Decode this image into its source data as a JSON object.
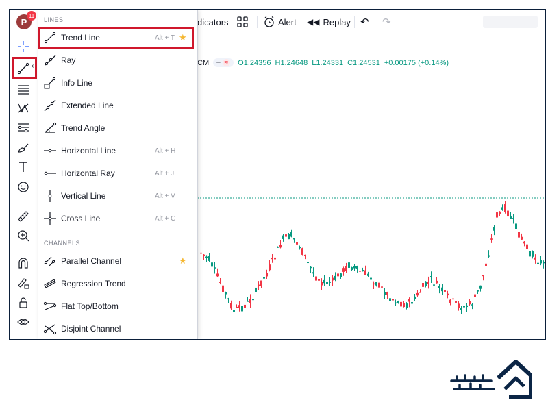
{
  "topbar": {
    "indicators_label": "dicators",
    "alert_label": "Alert",
    "replay_label": "Replay"
  },
  "account": {
    "avatar_letter": "P",
    "notification_count": "11"
  },
  "symbol": {
    "symbol_fragment": "CM",
    "open": "O1.24356",
    "high": "H1.24648",
    "low": "L1.24331",
    "close": "C1.24531",
    "change": "+0.00175 (+0.14%)"
  },
  "menu": {
    "lines_header": "LINES",
    "channels_header": "CHANNELS",
    "lines": [
      {
        "label": "Trend Line",
        "shortcut": "Alt + T",
        "star": "★"
      },
      {
        "label": "Ray",
        "shortcut": "",
        "star": ""
      },
      {
        "label": "Info Line",
        "shortcut": "",
        "star": ""
      },
      {
        "label": "Extended Line",
        "shortcut": "",
        "star": ""
      },
      {
        "label": "Trend Angle",
        "shortcut": "",
        "star": ""
      },
      {
        "label": "Horizontal Line",
        "shortcut": "Alt + H",
        "star": ""
      },
      {
        "label": "Horizontal Ray",
        "shortcut": "Alt + J",
        "star": ""
      },
      {
        "label": "Vertical Line",
        "shortcut": "Alt + V",
        "star": ""
      },
      {
        "label": "Cross Line",
        "shortcut": "Alt + C",
        "star": ""
      }
    ],
    "channels": [
      {
        "label": "Parallel Channel",
        "shortcut": "",
        "star": "★"
      },
      {
        "label": "Regression Trend",
        "shortcut": "",
        "star": ""
      },
      {
        "label": "Flat Top/Bottom",
        "shortcut": "",
        "star": ""
      },
      {
        "label": "Disjoint Channel",
        "shortcut": "",
        "star": ""
      }
    ]
  },
  "colors": {
    "up": "#089981",
    "down": "#f23645",
    "highlight": "#d0182c",
    "logo": "#0b2545"
  },
  "icons": {
    "left_toolbar": [
      "crosshair-icon",
      "trend-line-icon",
      "horizontal-lines-icon",
      "pattern-icon",
      "fib-icon",
      "brush-icon",
      "text-icon",
      "emoji-icon",
      "ruler-icon",
      "zoom-in-icon",
      "magnet-icon",
      "lock-drawing-icon",
      "unlock-icon",
      "eye-icon"
    ]
  }
}
